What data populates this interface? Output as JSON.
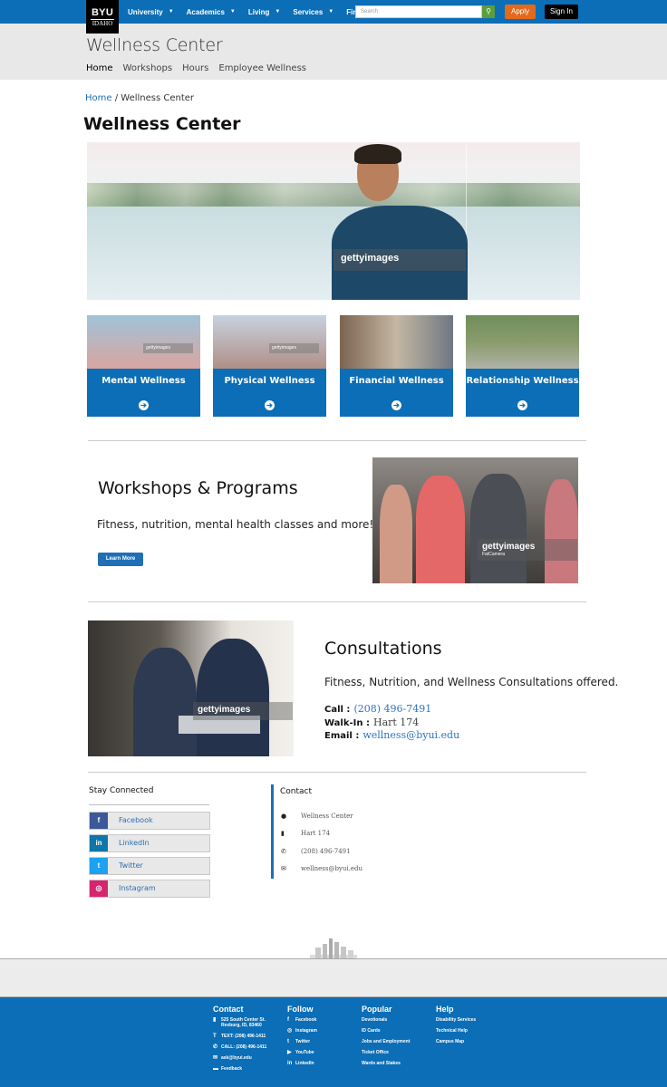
{
  "header": {
    "logo_top": "BYU",
    "logo_bottom": "IDAHO",
    "nav": [
      {
        "label": "University"
      },
      {
        "label": "Academics"
      },
      {
        "label": "Living"
      },
      {
        "label": "Services"
      },
      {
        "label": "Find"
      }
    ],
    "search_placeholder": "Search",
    "apply_label": "Apply",
    "signin_label": "Sign In"
  },
  "site": {
    "title": "Wellness Center",
    "subnav": [
      "Home",
      "Workshops",
      "Hours",
      "Employee Wellness"
    ]
  },
  "breadcrumb": {
    "home": "Home",
    "sep": " / ",
    "current": "Wellness Center"
  },
  "page_title": "Wellness Center",
  "hero": {
    "watermark": "gettyimages"
  },
  "cards": [
    {
      "label": "Mental Wellness",
      "watermark": "gettyimages",
      "color": "#e79494"
    },
    {
      "label": "Physical Wellness",
      "watermark": "gettyimages",
      "color": "#a7b6c8"
    },
    {
      "label": "Financial Wellness",
      "watermark": "",
      "color": "#8b6f55"
    },
    {
      "label": "Relationship Wellness",
      "watermark": "",
      "color": "#7b8f5d"
    }
  ],
  "workshops": {
    "title": "Workshops & Programs",
    "text": "Fitness, nutrition, mental health classes and more!",
    "button": "Learn More",
    "watermark": "gettyimages",
    "watermark_sub": "FatCamera"
  },
  "consultations": {
    "title": "Consultations",
    "text": "Fitness, Nutrition, and Wellness Consultations offered.",
    "call_label": "Call :",
    "call_value": "(208) 496-7491",
    "walkin_label": "Walk-In :",
    "walkin_value": "Hart 174",
    "email_label": "Email :",
    "email_value": "wellness@byui.edu",
    "watermark": "gettyimages"
  },
  "stay_connected": {
    "title": "Stay Connected",
    "items": [
      {
        "label": "Facebook",
        "icon": "f",
        "color": "#3b5998"
      },
      {
        "label": "LinkedIn",
        "icon": "in",
        "color": "#0e76a8"
      },
      {
        "label": "Twitter",
        "icon": "t",
        "color": "#1da1f2"
      },
      {
        "label": "Instagram",
        "icon": "◎",
        "color": "#d6256f"
      }
    ]
  },
  "contact": {
    "title": "Contact",
    "rows": [
      {
        "icon": "person-icon",
        "glyph": "●",
        "text": "Wellness Center"
      },
      {
        "icon": "building-icon",
        "glyph": "▮",
        "text": "Hart 174"
      },
      {
        "icon": "phone-icon",
        "glyph": "✆",
        "text": "(208) 496-7491"
      },
      {
        "icon": "mail-icon",
        "glyph": "✉",
        "text": "wellness@byui.edu"
      }
    ]
  },
  "footer": {
    "contact": {
      "title": "Contact",
      "address_1": "525 South Center St.",
      "address_2": "Rexburg, ID, 83460",
      "text": "TEXT: (208) 496-1411",
      "call": "CALL: (208) 496-1411",
      "email": "ask@byui.edu",
      "feedback": "Feedback"
    },
    "follow": {
      "title": "Follow",
      "items": [
        "Facebook",
        "Instagram",
        "Twitter",
        "YouTube",
        "LinkedIn"
      ]
    },
    "popular": {
      "title": "Popular",
      "items": [
        "Devotionals",
        "ID Cards",
        "Jobs and Employment",
        "Ticket Office",
        "Wards and Stakes"
      ]
    },
    "help": {
      "title": "Help",
      "items": [
        "Disability Services",
        "Technical Help",
        "Campus Map"
      ]
    }
  }
}
